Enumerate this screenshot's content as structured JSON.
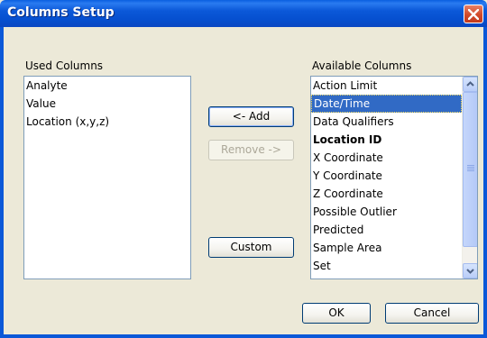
{
  "window": {
    "title": "Columns Setup"
  },
  "used_columns": {
    "label": "Used Columns",
    "items": [
      "Analyte",
      "Value",
      "Location (x,y,z)"
    ]
  },
  "available_columns": {
    "label": "Available Columns",
    "items": [
      {
        "label": "Action Limit",
        "selected": false,
        "bold": false
      },
      {
        "label": "Date/Time",
        "selected": true,
        "bold": false
      },
      {
        "label": "Data Qualifiers",
        "selected": false,
        "bold": false
      },
      {
        "label": "Location ID",
        "selected": false,
        "bold": true
      },
      {
        "label": "X Coordinate",
        "selected": false,
        "bold": false
      },
      {
        "label": "Y Coordinate",
        "selected": false,
        "bold": false
      },
      {
        "label": "Z Coordinate",
        "selected": false,
        "bold": false
      },
      {
        "label": "Possible Outlier",
        "selected": false,
        "bold": false
      },
      {
        "label": "Predicted",
        "selected": false,
        "bold": false
      },
      {
        "label": "Sample Area",
        "selected": false,
        "bold": false
      },
      {
        "label": "Set",
        "selected": false,
        "bold": false
      }
    ]
  },
  "buttons": {
    "add": "<- Add",
    "remove": "Remove ->",
    "custom": "Custom",
    "ok": "OK",
    "cancel": "Cancel"
  },
  "colors": {
    "titlebar": "#0b58d8",
    "selection": "#316ac5",
    "dialog_bg": "#ece9d8"
  }
}
